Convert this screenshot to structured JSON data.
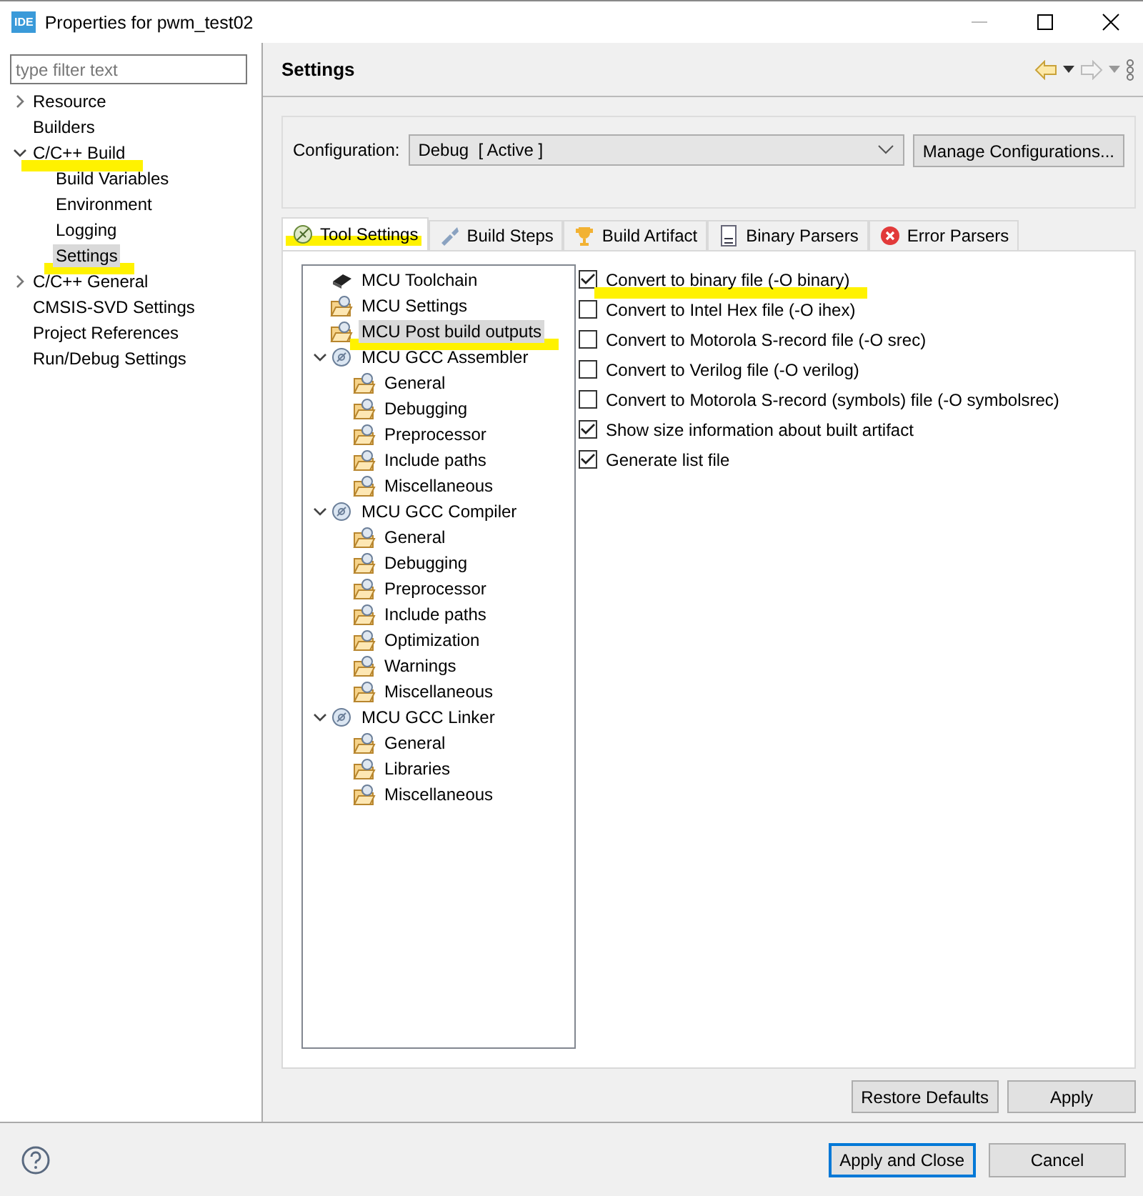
{
  "window": {
    "title": "Properties for pwm_test02",
    "app_badge": "IDE"
  },
  "sidebar": {
    "filter": {
      "placeholder": "type filter text"
    },
    "items": [
      {
        "label": "Resource",
        "expanded": false,
        "selected": false,
        "highlighted": false
      },
      {
        "label": "Builders",
        "selected": false,
        "highlighted": false
      },
      {
        "label": "C/C++ Build",
        "expanded": true,
        "selected": false,
        "highlighted": true,
        "children": [
          {
            "label": "Build Variables",
            "selected": false,
            "highlighted": false
          },
          {
            "label": "Environment",
            "selected": false,
            "highlighted": false
          },
          {
            "label": "Logging",
            "selected": false,
            "highlighted": false
          },
          {
            "label": "Settings",
            "selected": true,
            "highlighted": true
          }
        ]
      },
      {
        "label": "C/C++ General",
        "expanded": false,
        "selected": false,
        "highlighted": false
      },
      {
        "label": "CMSIS-SVD Settings",
        "selected": false,
        "highlighted": false
      },
      {
        "label": "Project References",
        "selected": false,
        "highlighted": false
      },
      {
        "label": "Run/Debug Settings",
        "selected": false,
        "highlighted": false
      }
    ]
  },
  "page": {
    "title": "Settings",
    "configuration": {
      "label": "Configuration:",
      "value": "Debug  [ Active ]",
      "manage_button": "Manage Configurations..."
    },
    "tabs": [
      {
        "label": "Tool Settings",
        "kind": "tool",
        "selected": true,
        "highlighted": true
      },
      {
        "label": "Build Steps",
        "kind": "steps",
        "selected": false,
        "highlighted": false
      },
      {
        "label": "Build Artifact",
        "kind": "trophy",
        "selected": false,
        "highlighted": false
      },
      {
        "label": "Binary Parsers",
        "kind": "binary",
        "selected": false,
        "highlighted": false
      },
      {
        "label": "Error Parsers",
        "kind": "error",
        "selected": false,
        "highlighted": false
      }
    ],
    "tool_tree": [
      {
        "label": "MCU Toolchain",
        "kind": "chip",
        "selected": false,
        "highlighted": false
      },
      {
        "label": "MCU Settings",
        "kind": "folder",
        "selected": false,
        "highlighted": false
      },
      {
        "label": "MCU Post build outputs",
        "kind": "folder",
        "selected": true,
        "highlighted": true
      },
      {
        "label": "MCU GCC Assembler",
        "kind": "tool",
        "selected": false,
        "highlighted": false,
        "expanded": true,
        "children": [
          {
            "label": "General",
            "kind": "folder",
            "selected": false,
            "highlighted": false
          },
          {
            "label": "Debugging",
            "kind": "folder",
            "selected": false,
            "highlighted": false
          },
          {
            "label": "Preprocessor",
            "kind": "folder",
            "selected": false,
            "highlighted": false
          },
          {
            "label": "Include paths",
            "kind": "folder",
            "selected": false,
            "highlighted": false
          },
          {
            "label": "Miscellaneous",
            "kind": "folder",
            "selected": false,
            "highlighted": false
          }
        ]
      },
      {
        "label": "MCU GCC Compiler",
        "kind": "tool",
        "selected": false,
        "highlighted": false,
        "expanded": true,
        "children": [
          {
            "label": "General",
            "kind": "folder",
            "selected": false,
            "highlighted": false
          },
          {
            "label": "Debugging",
            "kind": "folder",
            "selected": false,
            "highlighted": false
          },
          {
            "label": "Preprocessor",
            "kind": "folder",
            "selected": false,
            "highlighted": false
          },
          {
            "label": "Include paths",
            "kind": "folder",
            "selected": false,
            "highlighted": false
          },
          {
            "label": "Optimization",
            "kind": "folder",
            "selected": false,
            "highlighted": false
          },
          {
            "label": "Warnings",
            "kind": "folder",
            "selected": false,
            "highlighted": false
          },
          {
            "label": "Miscellaneous",
            "kind": "folder",
            "selected": false,
            "highlighted": false
          }
        ]
      },
      {
        "label": "MCU GCC Linker",
        "kind": "tool",
        "selected": false,
        "highlighted": false,
        "expanded": true,
        "children": [
          {
            "label": "General",
            "kind": "folder",
            "selected": false,
            "highlighted": false
          },
          {
            "label": "Libraries",
            "kind": "folder",
            "selected": false,
            "highlighted": false
          },
          {
            "label": "Miscellaneous",
            "kind": "folder",
            "selected": false,
            "highlighted": false
          }
        ]
      }
    ],
    "options": [
      {
        "label": "Convert to binary file (-O binary)",
        "checked": true,
        "highlighted": true
      },
      {
        "label": "Convert to Intel Hex file (-O ihex)",
        "checked": false,
        "highlighted": false
      },
      {
        "label": "Convert to Motorola S-record file (-O srec)",
        "checked": false,
        "highlighted": false
      },
      {
        "label": "Convert to Verilog file (-O verilog)",
        "checked": false,
        "highlighted": false
      },
      {
        "label": "Convert to Motorola S-record (symbols) file (-O symbolsrec)",
        "checked": false,
        "highlighted": false
      },
      {
        "label": "Show size information about built artifact",
        "checked": true,
        "highlighted": false
      },
      {
        "label": "Generate list file",
        "checked": true,
        "highlighted": false
      }
    ],
    "page_buttons": [
      "Restore Defaults",
      "Apply"
    ]
  },
  "footer": {
    "buttons": [
      {
        "label": "Apply and Close",
        "default": true
      },
      {
        "label": "Cancel",
        "default": false
      }
    ]
  }
}
